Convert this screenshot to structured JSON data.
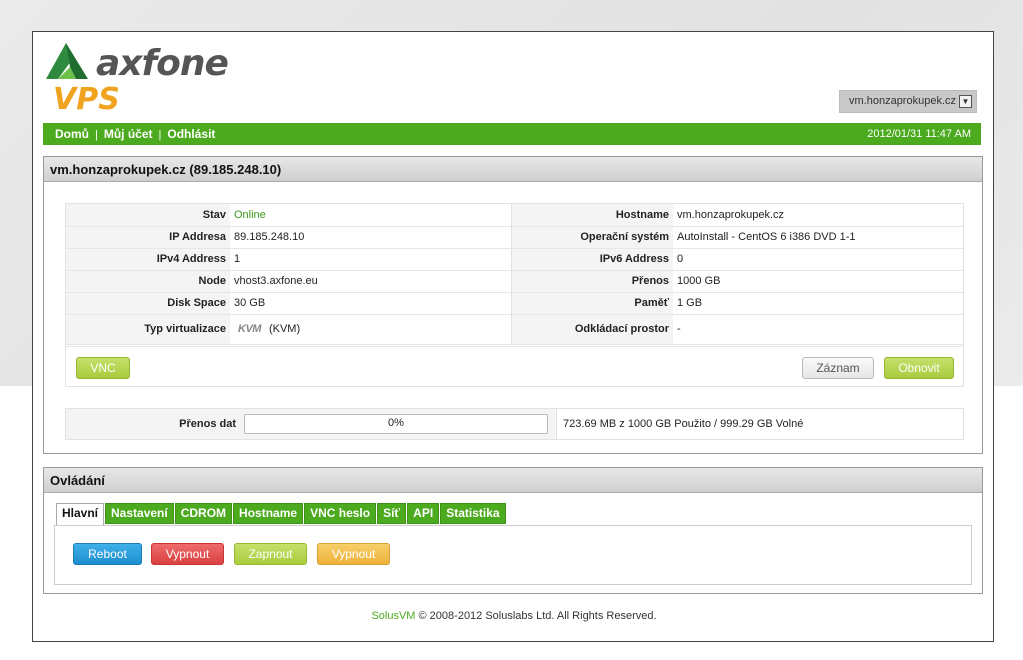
{
  "header": {
    "logo_text": "axfone",
    "product": "VPS",
    "server_select": "vm.honzaprokupek.cz"
  },
  "nav": {
    "links": [
      "Domů",
      "Můj účet",
      "Odhlásit"
    ],
    "separator": "|",
    "datetime": "2012/01/31 11:47 AM"
  },
  "vm_panel": {
    "title": "vm.honzaprokupek.cz (89.185.248.10)",
    "rows": [
      {
        "l1": "Stav",
        "v1": "Online",
        "l2": "Hostname",
        "v2": "vm.honzaprokupek.cz"
      },
      {
        "l1": "IP Addresa",
        "v1": "89.185.248.10",
        "l2": "Operační systém",
        "v2": "AutoInstall - CentOS 6 i386 DVD 1-1"
      },
      {
        "l1": "IPv4 Address",
        "v1": "1",
        "l2": "IPv6 Address",
        "v2": "0"
      },
      {
        "l1": "Node",
        "v1": "vhost3.axfone.eu",
        "l2": "Přenos",
        "v2": "1000 GB"
      },
      {
        "l1": "Disk Space",
        "v1": "30 GB",
        "l2": "Paměť",
        "v2": "1 GB"
      },
      {
        "l1": "Typ virtualizace",
        "v1_logo": "KVM",
        "v1": "(KVM)",
        "l2": "Odkládací prostor",
        "v2": "-"
      }
    ],
    "buttons": {
      "vnc": "VNC",
      "log": "Záznam",
      "refresh": "Obnovit"
    },
    "transfer": {
      "label": "Přenos dat",
      "percent": 0,
      "percent_text": "0%",
      "usage": "723.69 MB z 1000 GB Použito / 999.29 GB Volné"
    }
  },
  "control_panel": {
    "title": "Ovládání",
    "tabs": [
      "Hlavní",
      "Nastavení",
      "CDROM",
      "Hostname",
      "VNC heslo",
      "Síť",
      "API",
      "Statistika"
    ],
    "active_tab": 0,
    "actions": {
      "reboot": "Reboot",
      "shutdown": "Vypnout",
      "boot": "Zapnout",
      "poweroff": "Vypnout"
    }
  },
  "footer": {
    "brand": "SolusVM",
    "text": " © 2008-2012 Soluslabs Ltd. All Rights Reserved."
  },
  "colors": {
    "brand_green": "#4caa1e",
    "vps_orange": "#f0a31e"
  }
}
